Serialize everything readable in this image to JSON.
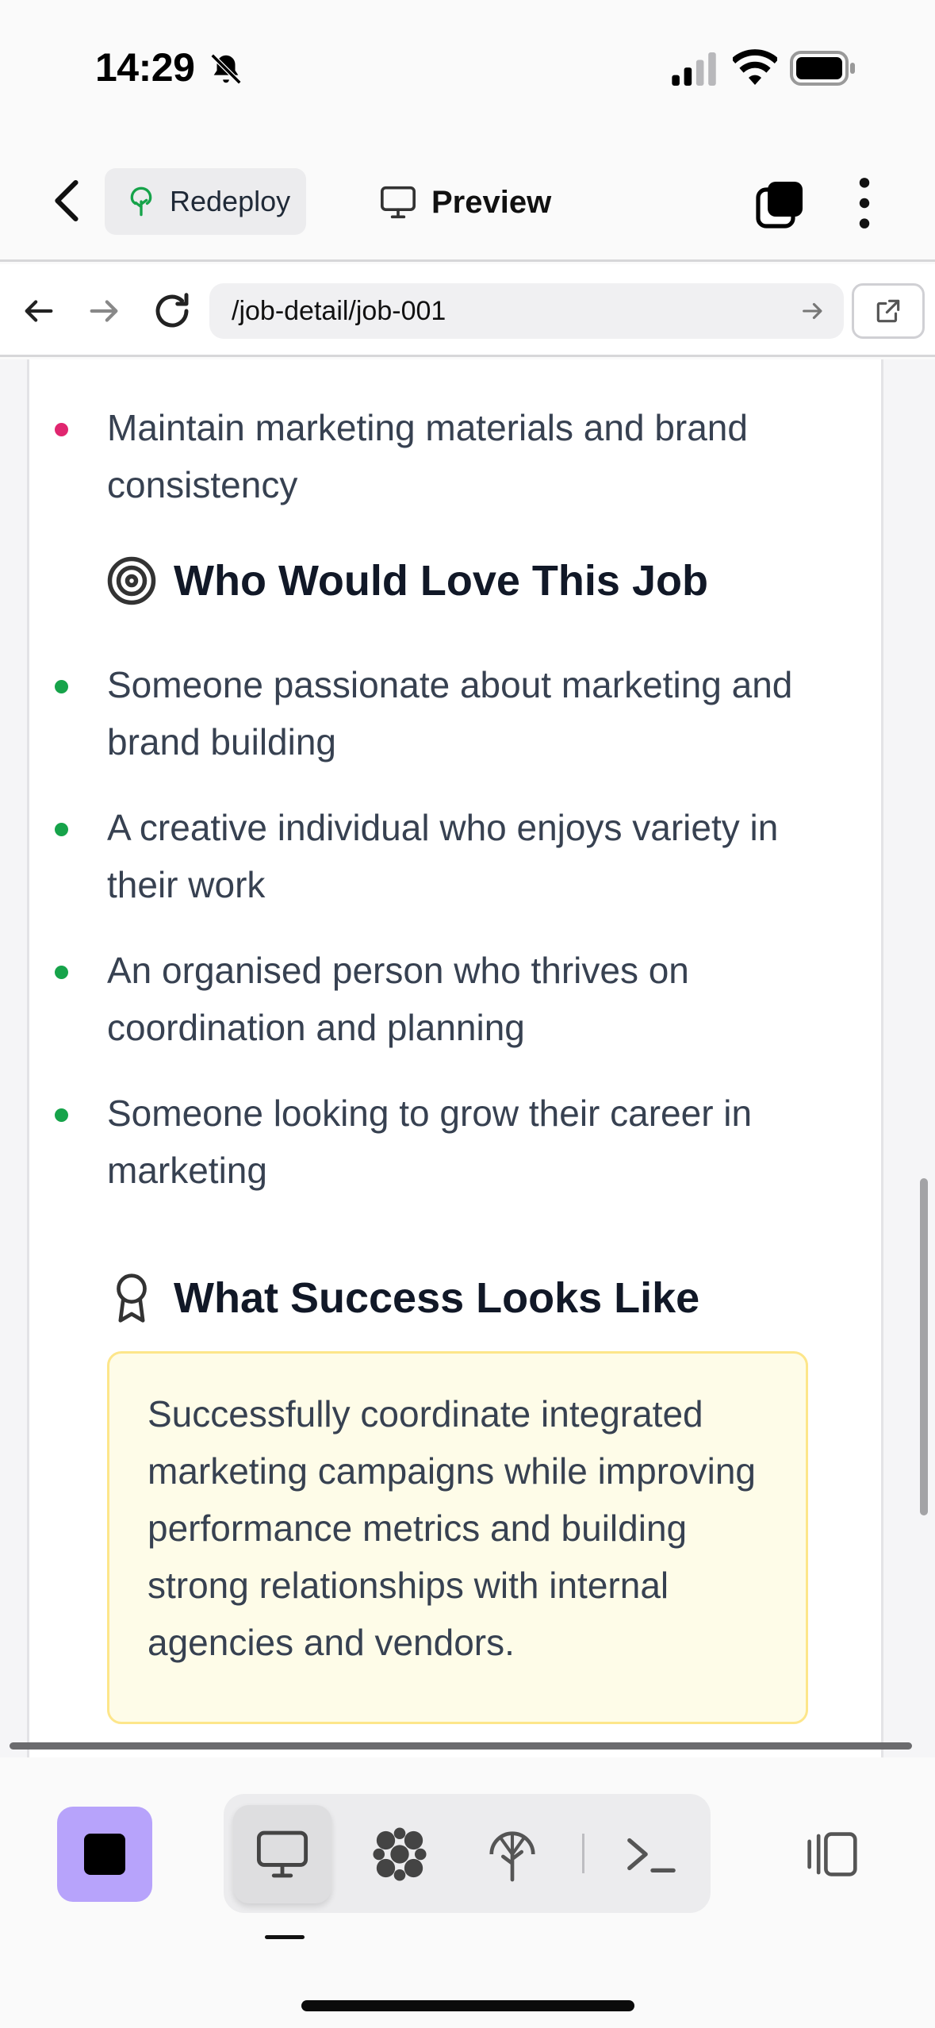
{
  "status_bar": {
    "time": "14:29"
  },
  "header": {
    "redeploy_label": "Redeploy",
    "preview_label": "Preview"
  },
  "url_bar": {
    "path": "/job-detail/job-001"
  },
  "content": {
    "previous_bullets": [
      {
        "text": "Maintain marketing materials and brand consistency"
      }
    ],
    "who_section": {
      "heading": "Who Would Love This Job",
      "bullets": [
        {
          "text": "Someone passionate about marketing and brand building"
        },
        {
          "text": "A creative individual who enjoys variety in their work"
        },
        {
          "text": "An organised person who thrives on coordination and planning"
        },
        {
          "text": "Someone looking to grow their career in marketing"
        }
      ]
    },
    "success_section": {
      "heading": "What Success Looks Like",
      "text": "Successfully coordinate integrated marketing campaigns while improving performance metrics and building strong relationships with internal agencies and vendors."
    }
  },
  "colors": {
    "accent_purple": "#b7a3fb",
    "bullet_pink": "#e0266f",
    "bullet_green": "#16a34a",
    "success_bg": "#fefce8",
    "success_border": "#fde68a"
  },
  "icons": {
    "redeploy": "tree-icon",
    "preview": "monitor-icon",
    "who_section": "target-icon",
    "success_section": "award-ribbon-icon",
    "toolbar": [
      "monitor-icon",
      "network-blob-icon",
      "deploy-tree-icon",
      "terminal-icon"
    ]
  }
}
